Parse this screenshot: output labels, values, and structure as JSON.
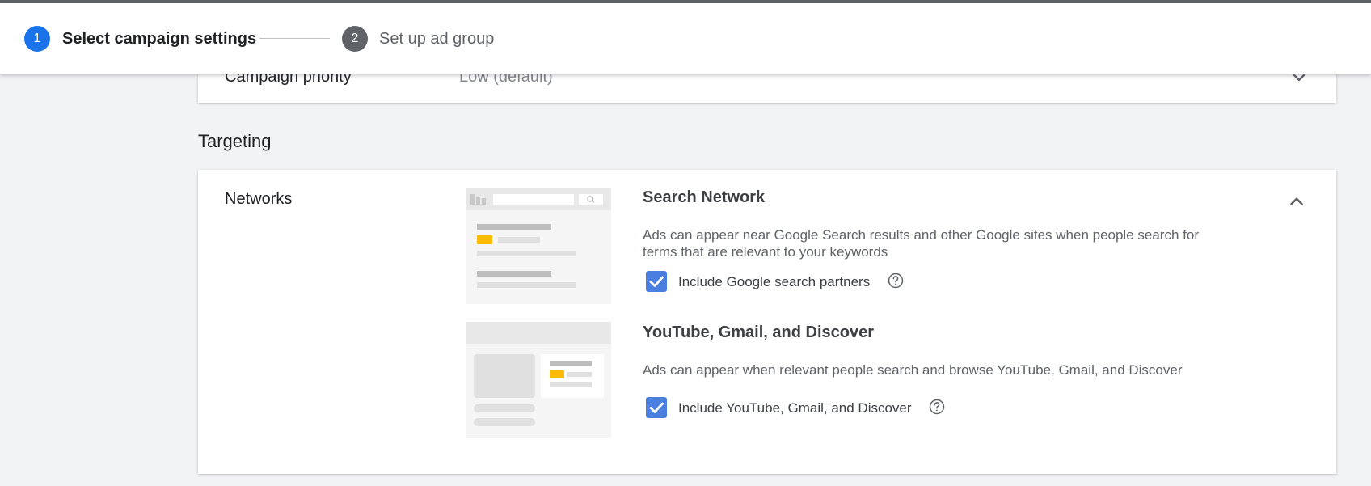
{
  "stepper": {
    "steps": [
      {
        "number": "1",
        "label": "Select campaign settings"
      },
      {
        "number": "2",
        "label": "Set up ad group"
      }
    ],
    "active_color": "#1a73e8"
  },
  "campaign_priority": {
    "label": "Campaign priority",
    "value": "Low (default)"
  },
  "targeting": {
    "heading": "Targeting",
    "networks_label": "Networks",
    "search_network": {
      "title": "Search Network",
      "description": "Ads can appear near Google Search results and other Google sites when people search for terms that are relevant to your keywords",
      "checkbox_label": "Include Google search partners",
      "checked": true
    },
    "youtube_network": {
      "title": "YouTube, Gmail, and Discover",
      "description": "Ads can appear when relevant people search and browse YouTube, Gmail, and Discover",
      "checkbox_label": "Include YouTube, Gmail, and Discover",
      "checked": true
    }
  },
  "icons": {
    "expand": "chevron-down-icon",
    "collapse": "chevron-up-icon",
    "help": "help-circle-icon",
    "check": "check-icon"
  },
  "colors": {
    "checkbox": "#4a7fe0",
    "illustration_accent": "#fbbc04",
    "page_background": "#f1f3f4"
  }
}
